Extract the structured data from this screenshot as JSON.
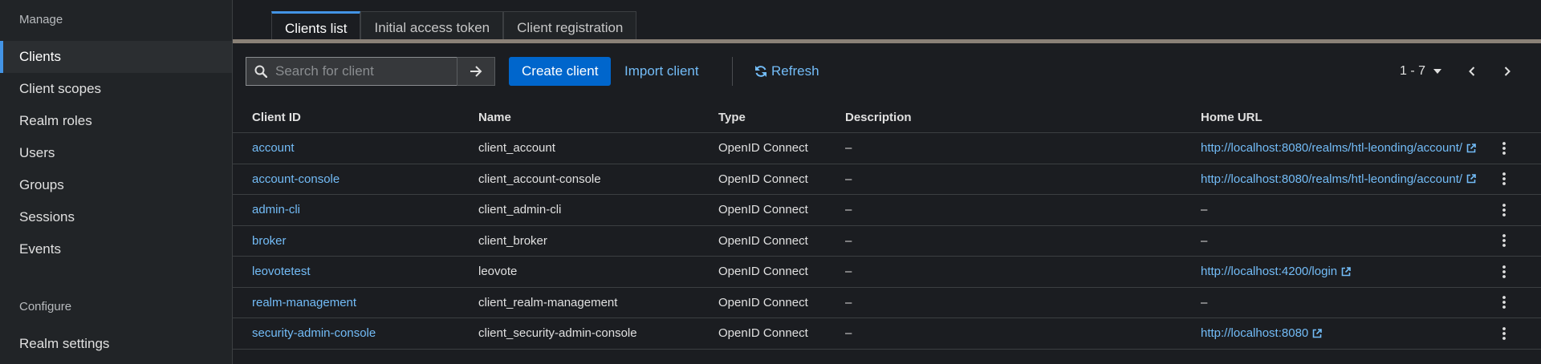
{
  "sidebar": {
    "manage_title": "Manage",
    "items": [
      {
        "label": "Clients"
      },
      {
        "label": "Client scopes"
      },
      {
        "label": "Realm roles"
      },
      {
        "label": "Users"
      },
      {
        "label": "Groups"
      },
      {
        "label": "Sessions"
      },
      {
        "label": "Events"
      }
    ],
    "configure_title": "Configure",
    "configure_items": [
      {
        "label": "Realm settings"
      }
    ]
  },
  "tabs": [
    {
      "label": "Clients list"
    },
    {
      "label": "Initial access token"
    },
    {
      "label": "Client registration"
    }
  ],
  "toolbar": {
    "search_placeholder": "Search for client",
    "search_value": "",
    "create_label": "Create client",
    "import_label": "Import client",
    "refresh_label": "Refresh",
    "pagination": "1 - 7"
  },
  "table": {
    "headers": {
      "client_id": "Client ID",
      "name": "Name",
      "type": "Type",
      "description": "Description",
      "home_url": "Home URL"
    },
    "rows": [
      {
        "client_id": "account",
        "name": "client_account",
        "type": "OpenID Connect",
        "description": "–",
        "home_url": "http://localhost:8080/realms/htl-leonding/account/"
      },
      {
        "client_id": "account-console",
        "name": "client_account-console",
        "type": "OpenID Connect",
        "description": "–",
        "home_url": "http://localhost:8080/realms/htl-leonding/account/"
      },
      {
        "client_id": "admin-cli",
        "name": "client_admin-cli",
        "type": "OpenID Connect",
        "description": "–",
        "home_url": "–"
      },
      {
        "client_id": "broker",
        "name": "client_broker",
        "type": "OpenID Connect",
        "description": "–",
        "home_url": "–"
      },
      {
        "client_id": "leovotetest",
        "name": "leovote",
        "type": "OpenID Connect",
        "description": "–",
        "home_url": "http://localhost:4200/login"
      },
      {
        "client_id": "realm-management",
        "name": "client_realm-management",
        "type": "OpenID Connect",
        "description": "–",
        "home_url": "–"
      },
      {
        "client_id": "security-admin-console",
        "name": "client_security-admin-console",
        "type": "OpenID Connect",
        "description": "–",
        "home_url": "http://localhost:8080"
      }
    ]
  },
  "colors": {
    "accent": "#0066cc",
    "link": "#73bcf7",
    "background": "#1b1d21",
    "sidebar": "#212427"
  }
}
